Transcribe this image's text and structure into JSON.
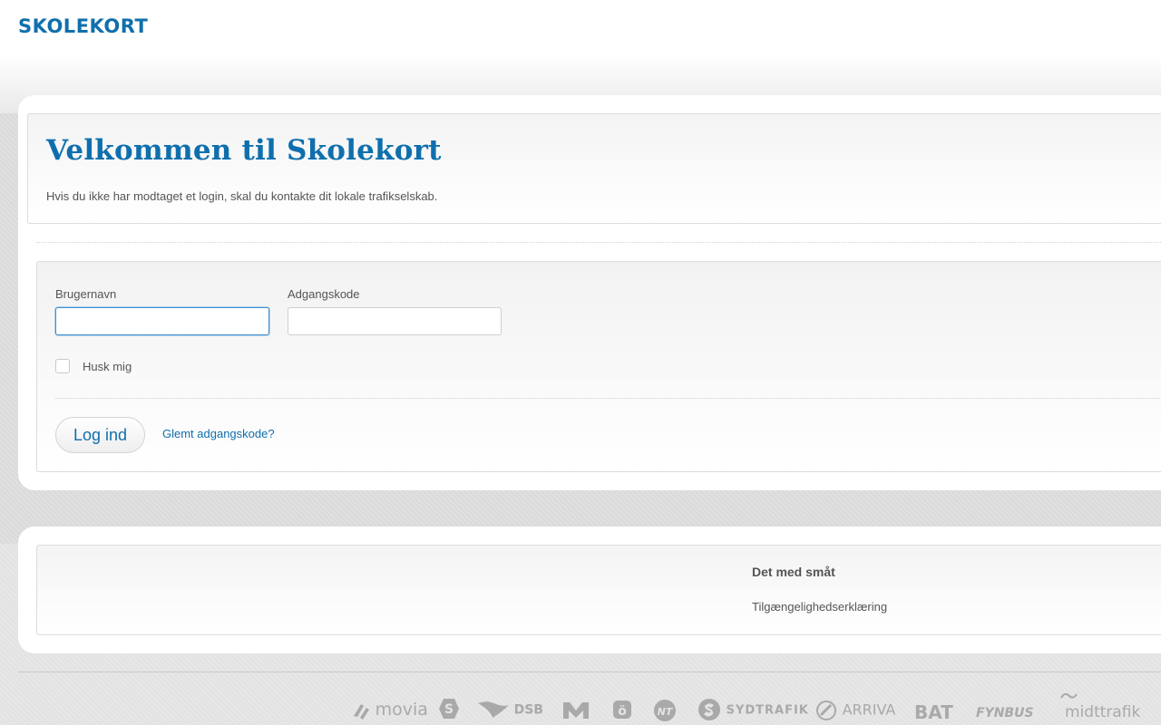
{
  "header": {
    "logo_text": "SKOLEKORT"
  },
  "intro": {
    "title": "Velkommen til Skolekort",
    "text": "Hvis du ikke har modtaget et login, skal du kontakte dit lokale trafikselskab."
  },
  "login_form": {
    "username_label": "Brugernavn",
    "username_value": "",
    "password_label": "Adgangskode",
    "password_value": "",
    "remember_label": "Husk mig",
    "remember_checked": false,
    "submit_label": "Log ind",
    "forgot_label": "Glemt adgangskode?"
  },
  "footer": {
    "heading": "Det med småt",
    "link": "Tilgængelighedserklæring"
  },
  "partners": [
    {
      "name": "movia",
      "icon": "movia-logo"
    },
    {
      "name": "",
      "icon": "s-train-logo"
    },
    {
      "name": "DSB",
      "icon": "dsb-logo"
    },
    {
      "name": "",
      "icon": "metro-logo"
    },
    {
      "name": "",
      "icon": "bornholm-logo"
    },
    {
      "name": "",
      "icon": "nt-logo"
    },
    {
      "name": "SYDTRAFIK",
      "icon": "sydtrafik-logo"
    },
    {
      "name": "ARRIVA",
      "icon": "arriva-logo"
    },
    {
      "name": "BAT",
      "icon": "bat-logo"
    },
    {
      "name": "FYNBUS",
      "icon": "fynbus-logo"
    },
    {
      "name": "midttrafik",
      "icon": "midttrafik-logo"
    }
  ],
  "colors": {
    "brand_blue": "#0f6fad",
    "text_grey": "#555555",
    "focus_blue": "#3d8fd1"
  }
}
